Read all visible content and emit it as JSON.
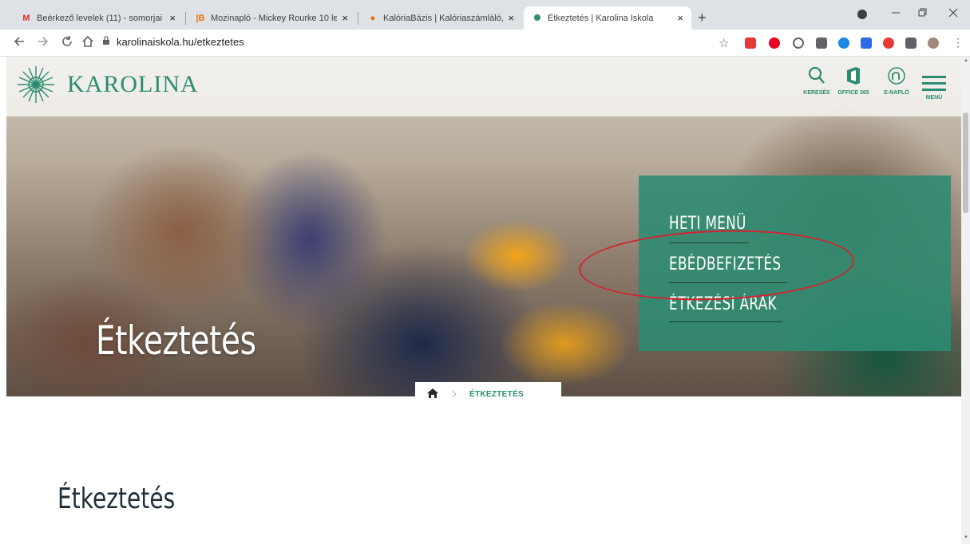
{
  "browser": {
    "tabs": [
      {
        "title": "Beérkező levelek (11) - somorjai",
        "favicon": "gmail-icon",
        "favicon_text": "M",
        "favicon_color": "#d93025"
      },
      {
        "title": "Mozinapló - Mickey Rourke 10 le",
        "favicon": "mozinaplo-icon",
        "favicon_text": "|B",
        "favicon_color": "#e8710a"
      },
      {
        "title": "KalóriaBázis | Kalóriaszámláló, Ka",
        "favicon": "kaloriabazis-icon",
        "favicon_text": "●",
        "favicon_color": "#e37400"
      },
      {
        "title": "Étkeztetés | Karolina Iskola",
        "favicon": "karolina-icon",
        "favicon_text": "✺",
        "favicon_color": "#2b8c72"
      }
    ],
    "tab_close": "×",
    "new_tab": "+",
    "url": "karolinaiskola.hu/etkeztetes"
  },
  "site": {
    "logo_text": "KAROLINA",
    "header_icons": [
      {
        "label": "KERESÉS",
        "icon": "search-icon"
      },
      {
        "label": "OFFICE 365",
        "icon": "office-icon"
      },
      {
        "label": "E-NAPLÓ",
        "icon": "enaplo-icon"
      }
    ],
    "menu_label": "MENÜ",
    "accent_color": "#2b8c72"
  },
  "hero": {
    "title": "Étkeztetés",
    "menu": [
      "HETI MENÜ",
      "EBÉDBEFIZETÉS",
      "ÉTKEZÉSI ÁRAK"
    ]
  },
  "breadcrumb": {
    "current": "ÉTKEZTETÉS"
  },
  "content": {
    "title": "Étkeztetés"
  }
}
